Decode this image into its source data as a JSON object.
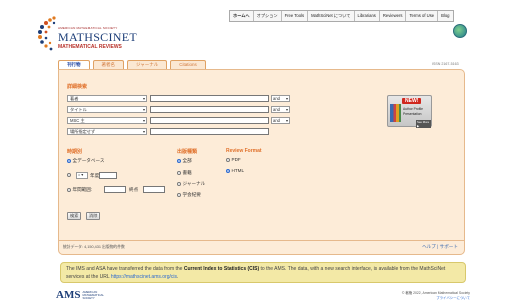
{
  "top_nav": {
    "items": [
      "ホームへ",
      "オプション",
      "Free Tools",
      "MathSciNet について",
      "Librarians",
      "Reviewers",
      "Terms of Use",
      "Blog"
    ]
  },
  "logo": {
    "ams_small": "AMERICAN MATHEMATICAL SOCIETY",
    "mathscinet": "MATHSCINET",
    "mathematical_reviews": "MATHEMATICAL REVIEWS"
  },
  "tabs": [
    "刊行物",
    "著者名",
    "ジャーナル",
    "Citations"
  ],
  "issn": "ISSN 2167-5163",
  "search": {
    "title": "詳細検索",
    "rows": [
      {
        "field": "著者",
        "op": "and"
      },
      {
        "field": "タイトル",
        "op": "and"
      },
      {
        "field": "MSC 主",
        "op": "and"
      },
      {
        "field": "場所指定せず",
        "op": ""
      }
    ]
  },
  "banner": {
    "new": "NEW!",
    "line1": "Author Profile",
    "line2": "Presentation",
    "more": "See More ▶"
  },
  "date_range": {
    "title": "時期別",
    "options": [
      {
        "label": "全データベース",
        "checked": true
      },
      {
        "label": "年度",
        "checked": false
      },
      {
        "label": "年間範囲:",
        "checked": false
      }
    ],
    "year_op": "= ▾",
    "end_label": "終点"
  },
  "pub_type": {
    "title": "出版種類",
    "options": [
      {
        "label": "全部",
        "checked": true
      },
      {
        "label": "書籍",
        "checked": false
      },
      {
        "label": "ジャーナル",
        "checked": false
      },
      {
        "label": "学会紀要",
        "checked": false
      }
    ]
  },
  "review_format": {
    "title": "Review Format",
    "options": [
      {
        "label": "PDF",
        "checked": false
      },
      {
        "label": "HTML",
        "checked": true
      }
    ]
  },
  "buttons": {
    "search": "検索",
    "reset": "消除"
  },
  "panel_footer": {
    "stats": "統計データ: 4,150,431 出版物的件数",
    "help": "ヘルプ",
    "support": "サポート"
  },
  "notice": {
    "part1": "The IMS and ASA have transferred the data from the ",
    "bold": "Current Index to Statistics (CIS)",
    "part2": " to the AMS. The data, with a new search interface, is available from the MathSciNet services at the URL ",
    "link": "https://mathscinet.ams.org/cis",
    "part3": "."
  },
  "footer": {
    "ams_mark": "AMS",
    "ams_sub1": "AMERICAN",
    "ams_sub2": "MATHEMATICAL",
    "ams_sub3": "SOCIETY",
    "copyright": "© 著権 2022, American Mathematical Society",
    "privacy": "プライバシーについて"
  }
}
